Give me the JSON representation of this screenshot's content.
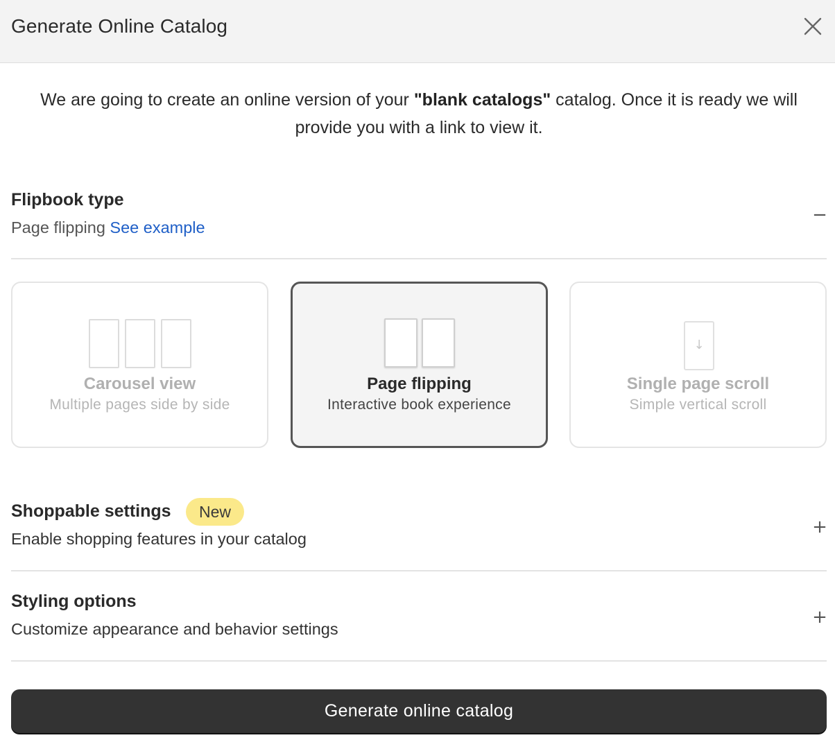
{
  "dialog": {
    "title": "Generate Online Catalog",
    "close_icon": "close-icon"
  },
  "intro": {
    "before": "We are going to create an online version of your ",
    "catalog_name": "\"blank catalogs\"",
    "after": " catalog. Once it is ready we will provide you with a link to view it."
  },
  "flipbook": {
    "title": "Flipbook type",
    "selected_label": "Page flipping",
    "example_link": "See example",
    "toggle": "−",
    "options": [
      {
        "title": "Carousel view",
        "description": "Multiple pages side by side",
        "selected": false
      },
      {
        "title": "Page flipping",
        "description": "Interactive book experience",
        "selected": true
      },
      {
        "title": "Single page scroll",
        "description": "Simple vertical scroll",
        "selected": false
      }
    ],
    "scroll_arrow": "↓"
  },
  "shoppable": {
    "title": "Shoppable settings",
    "badge": "New",
    "description": "Enable shopping features in your catalog",
    "toggle": "+"
  },
  "styling": {
    "title": "Styling options",
    "description": "Customize appearance and behavior settings",
    "toggle": "+"
  },
  "actions": {
    "generate_label": "Generate online catalog"
  },
  "colors": {
    "header_bg": "#f3f3f3",
    "link": "#1f5fc7",
    "badge_bg": "#fbe98a",
    "primary_button": "#333333"
  }
}
